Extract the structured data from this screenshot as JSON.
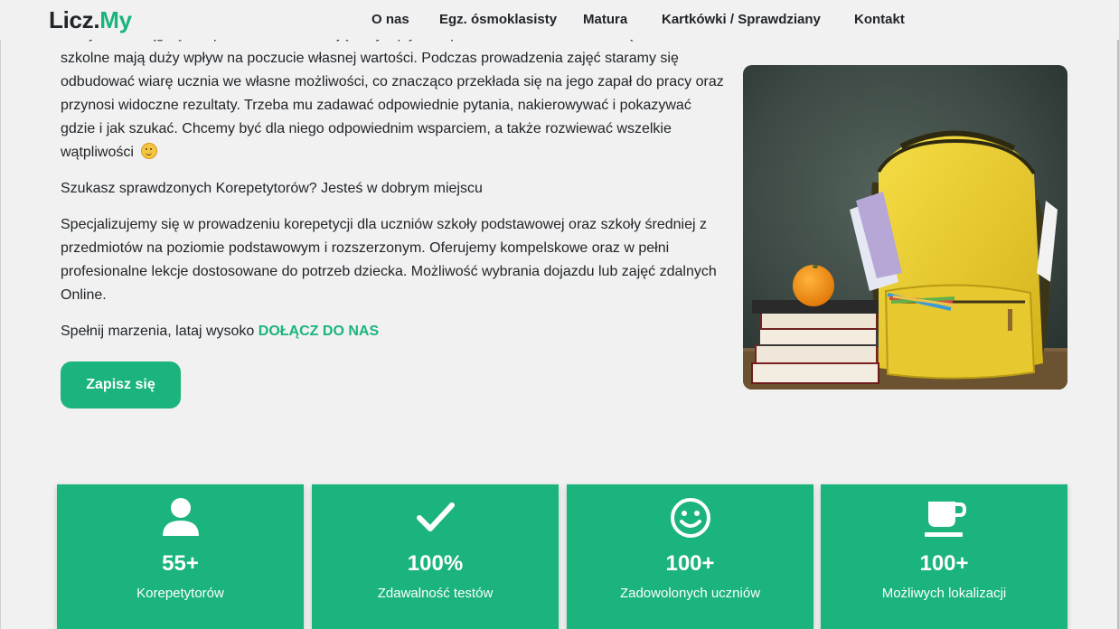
{
  "brand": {
    "name_main": "Licz.",
    "name_accent": "My"
  },
  "nav": {
    "items": [
      {
        "label": "O nas"
      },
      {
        "label": "Egz. ósmoklasisty"
      },
      {
        "label": "Matura"
      },
      {
        "label": "Kartkówki / Sprawdziany"
      },
      {
        "label": "Kontakt"
      }
    ]
  },
  "content": {
    "paragraph1_cut": "Wszystkie osiągnięcia i porażki szkolne mają duży wpływ na pewność siebie i samoocenę dziecka. Oceny",
    "paragraph1": "szkolne mają duży wpływ na poczucie własnej wartości. Podczas prowadzenia zajęć staramy się odbudować wiarę ucznia we własne możliwości, co znacząco przekłada się na jego zapał do pracy oraz przynosi widoczne rezultaty. Trzeba mu zadawać odpowiednie pytania, nakierowywać i pokazywać gdzie i jak szukać. Chcemy być dla niego odpowiednim wsparciem, a także rozwiewać wszelkie wątpliwości",
    "paragraph2": "Szukasz sprawdzonych Korepetytorów? Jesteś w dobrym miejscu",
    "paragraph3": "Specjalizujemy się w prowadzeniu korepetycji dla uczniów szkoły podstawowej oraz szkoły średniej z przedmiotów na poziomie podstawowym i rozszerzonym. Oferujemy kompelskowe oraz w pełni profesionalne lekcje dostosowane do potrzeb dziecka. Możliwość wybrania dojazdu lub zajęć zdalnych Online.",
    "paragraph4_text": "Spełnij marzenia, lataj wysoko",
    "paragraph4_link": "DOŁĄCZ DO NAS",
    "signup_button": "Zapisz się"
  },
  "stats": [
    {
      "icon": "user-icon",
      "value": "55+",
      "label": "Korepetytorów"
    },
    {
      "icon": "checkmark-icon",
      "value": "100%",
      "label": "Zdawalność testów"
    },
    {
      "icon": "smiley-icon",
      "value": "100+",
      "label": "Zadowolonych uczniów"
    },
    {
      "icon": "coffee-cup-icon",
      "value": "100+",
      "label": "Możliwych lokalizacji"
    }
  ],
  "colors": {
    "accent": "#1ab47c",
    "text": "#212529",
    "background": "#f1f1f1"
  }
}
